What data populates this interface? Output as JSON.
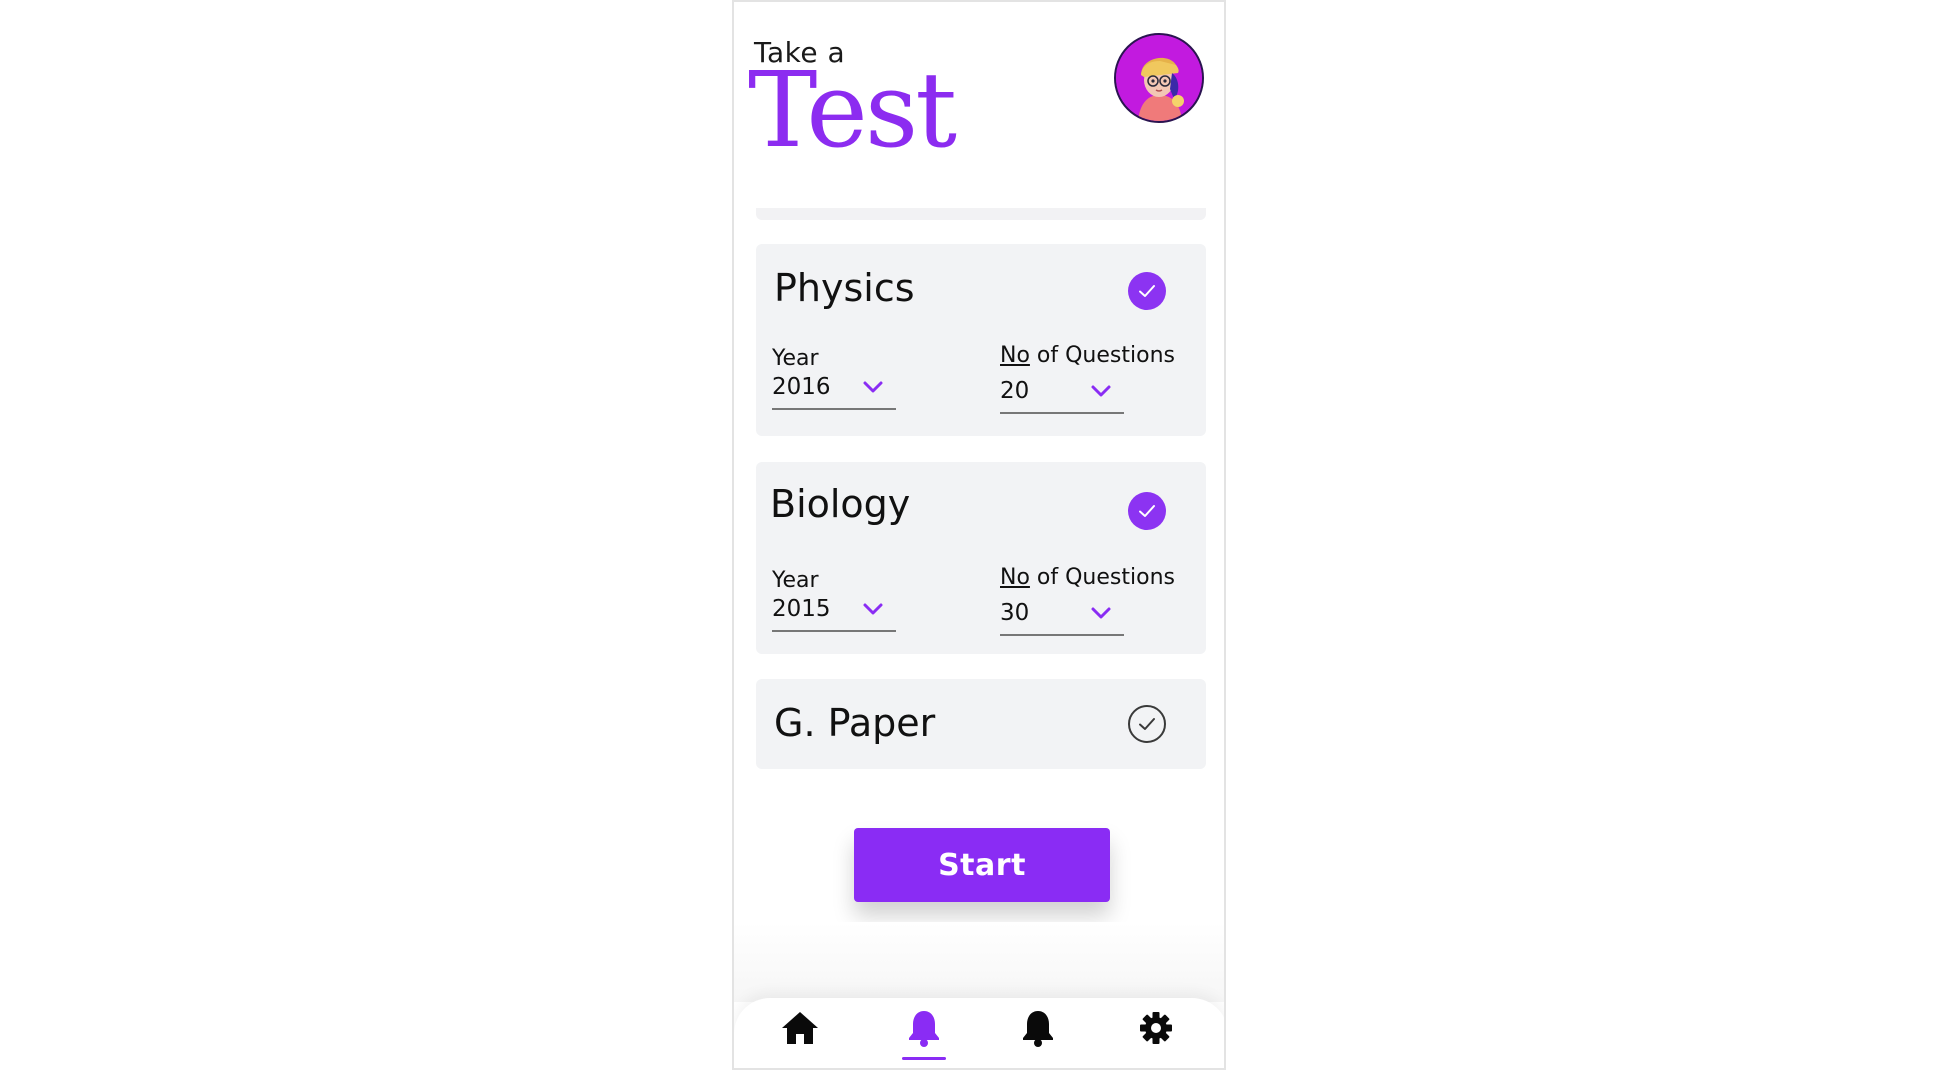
{
  "header": {
    "pre_title": "Take a",
    "title": "Test"
  },
  "subjects": [
    {
      "name": "Physics",
      "selected": true,
      "year_label": "Year",
      "year_value": "2016",
      "questions_label_abbr": "No",
      "questions_label_rest": " of Questions",
      "questions_value": "20"
    },
    {
      "name": "Biology",
      "selected": true,
      "year_label": "Year",
      "year_value": "2015",
      "questions_label_abbr": "No",
      "questions_label_rest": " of Questions",
      "questions_value": "30"
    },
    {
      "name": "G. Paper",
      "selected": false
    }
  ],
  "actions": {
    "start_label": "Start"
  },
  "nav": {
    "items": [
      "home-icon",
      "bell-icon",
      "bell-icon",
      "gear-icon"
    ],
    "active_index": 1
  },
  "colors": {
    "accent": "#8a2cf4",
    "card_bg": "#f2f3f5",
    "avatar_bg": "#c21adf"
  }
}
